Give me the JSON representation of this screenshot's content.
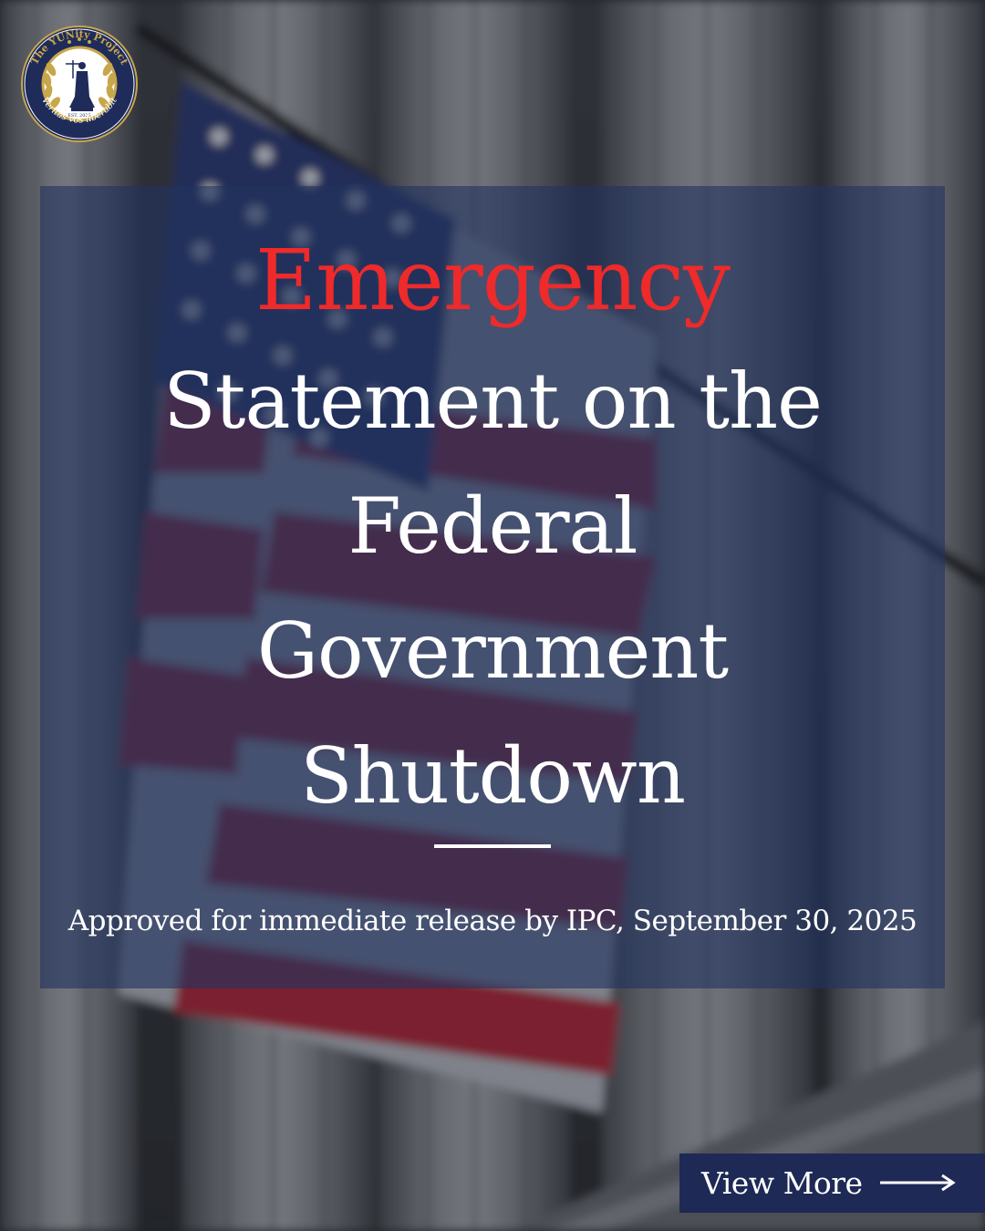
{
  "seal": {
    "ring_text": "The YUNity Project",
    "est_text": "EST. 2025",
    "motto_text": "Veritas vos liberabit",
    "colors": {
      "navy": "#1f2c5a",
      "gold": "#c8a64a"
    },
    "icon": "lady-justice-icon"
  },
  "headline": {
    "accent": "Emergency",
    "lines": [
      "Statement on the",
      "Federal",
      "Government",
      "Shutdown"
    ]
  },
  "release_note": "Approved for immediate release by IPC, September 30, 2025",
  "cta": {
    "label": "View More",
    "icon": "arrow-right-icon"
  },
  "colors": {
    "accent_red": "#ee2a2a",
    "panel_navy": "#223460",
    "button_navy": "#1e2a55",
    "text_white": "#ffffff"
  }
}
